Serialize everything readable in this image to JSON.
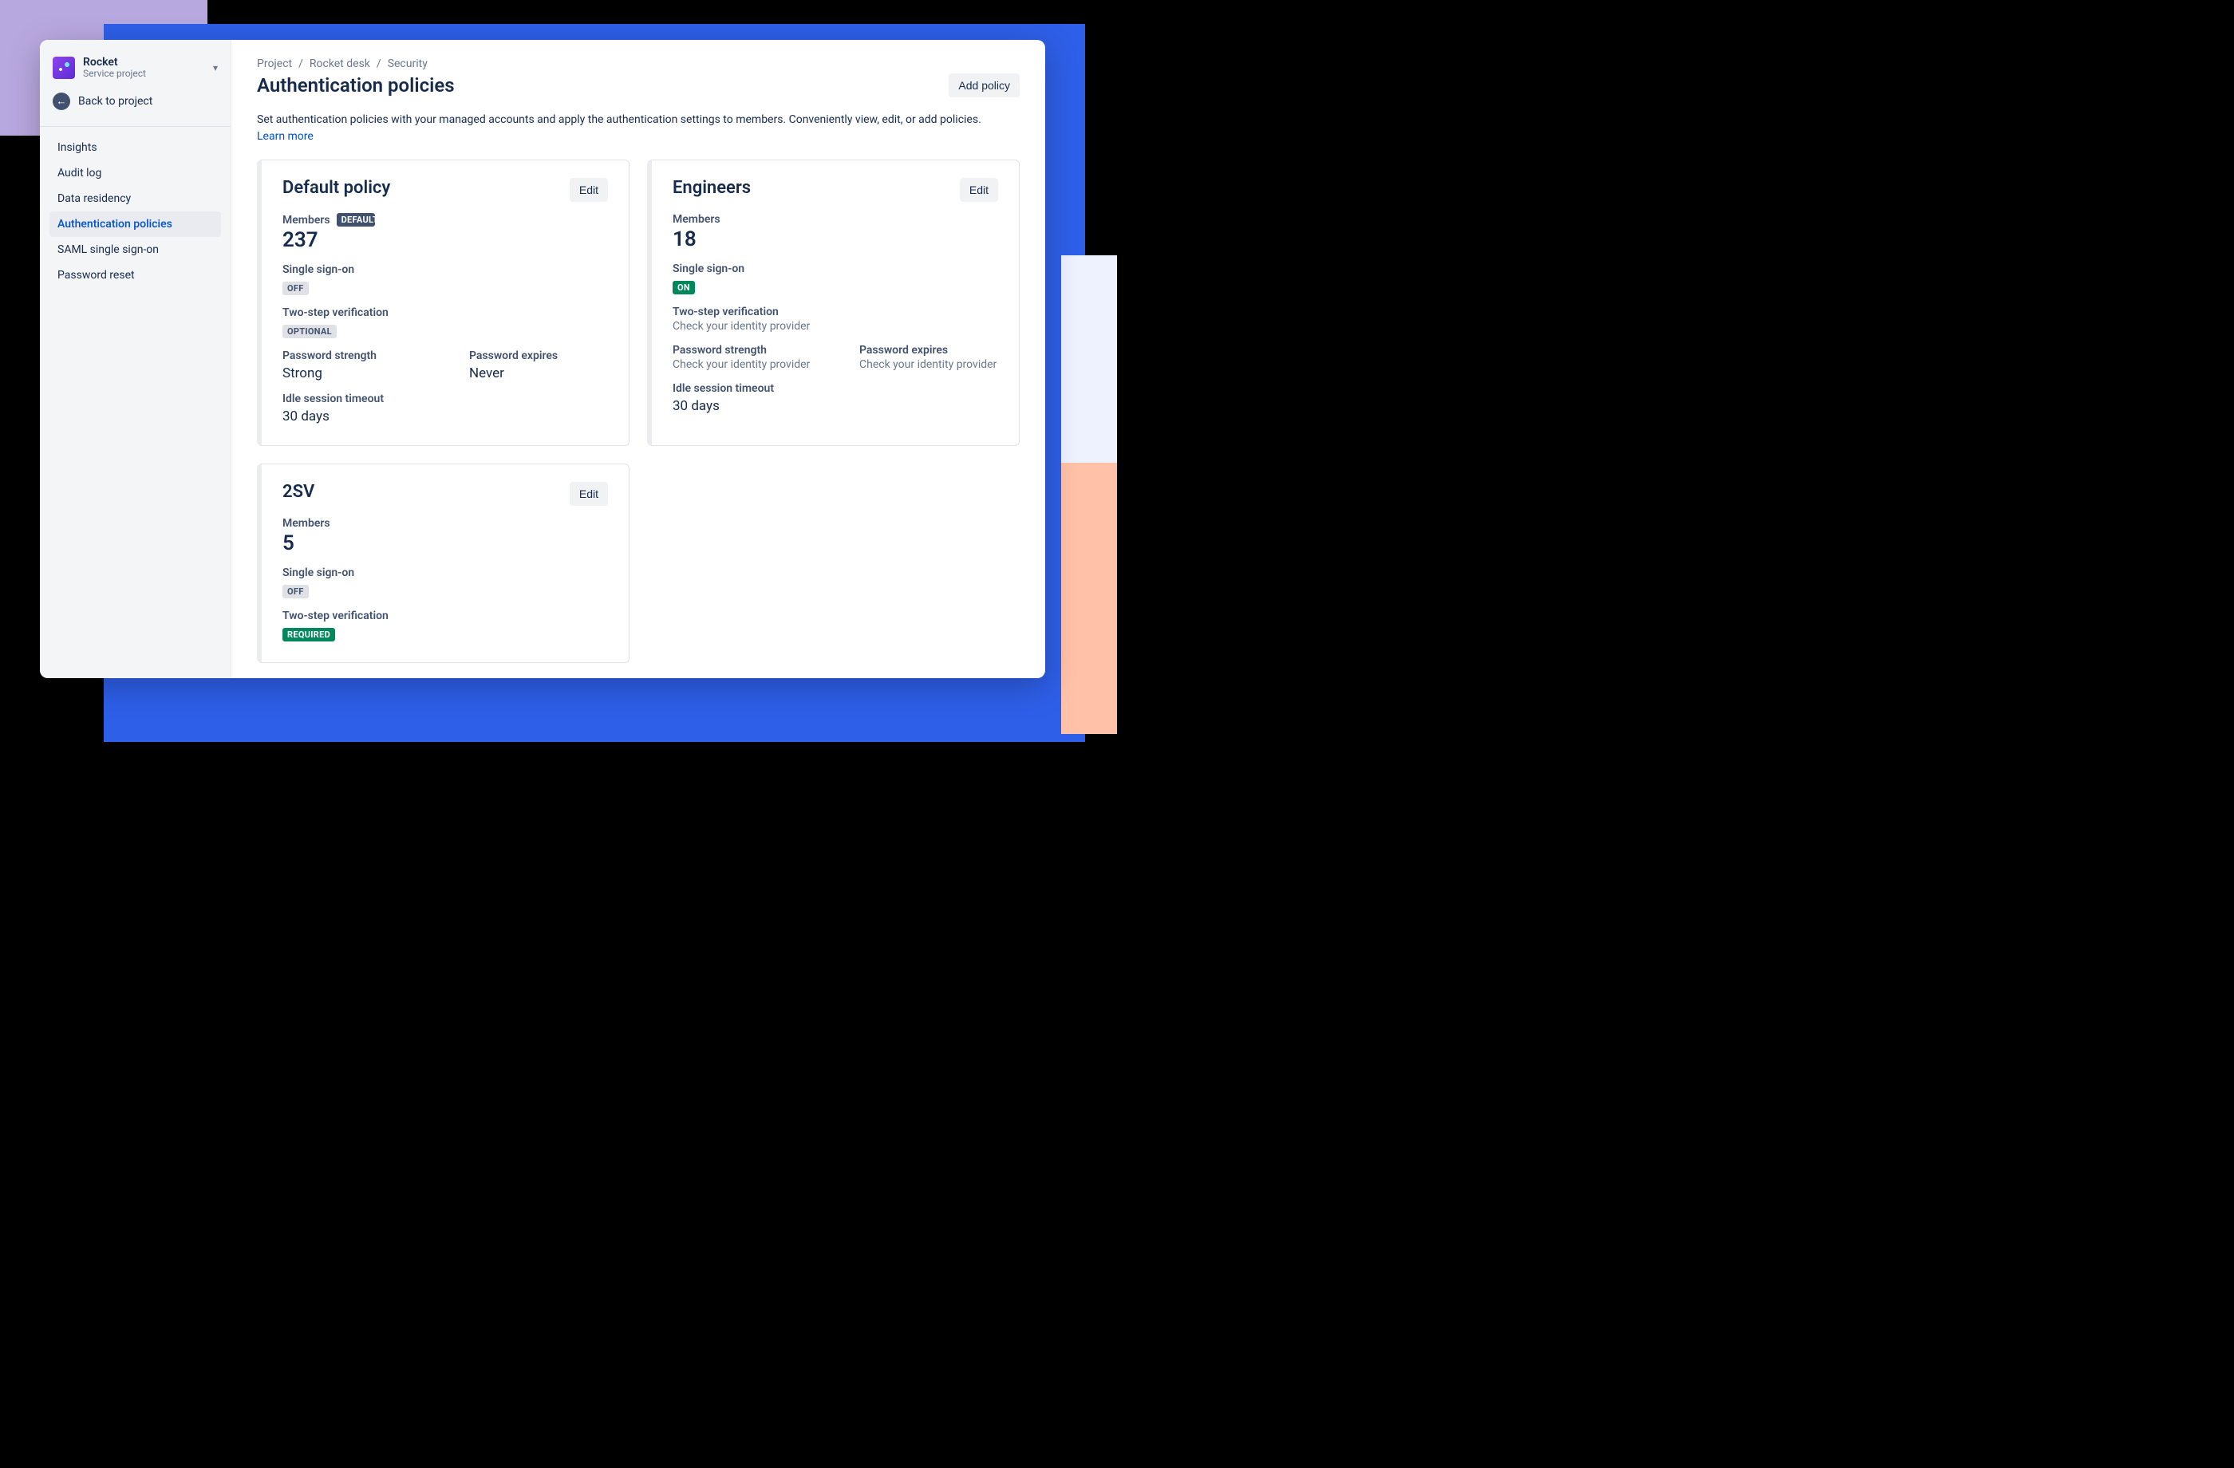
{
  "sidebar": {
    "project_name": "Rocket",
    "project_subtitle": "Service project",
    "back_label": "Back to project",
    "items": [
      {
        "label": "Insights"
      },
      {
        "label": "Audit log"
      },
      {
        "label": "Data residency"
      },
      {
        "label": "Authentication policies"
      },
      {
        "label": "SAML single sign-on"
      },
      {
        "label": "Password reset"
      }
    ],
    "active_index": 3
  },
  "breadcrumb": [
    "Project",
    "Rocket desk",
    "Security"
  ],
  "page_title": "Authentication policies",
  "add_button": "Add policy",
  "subtitle_text": "Set authentication policies with your managed accounts and apply the authentication settings to members. Conveniently view, edit, or add policies. ",
  "learn_more": "Learn more",
  "edit_label": "Edit",
  "labels": {
    "members": "Members",
    "sso": "Single sign-on",
    "twostep": "Two-step verification",
    "pw_strength": "Password strength",
    "pw_expires": "Password expires",
    "idle": "Idle session timeout"
  },
  "policies": [
    {
      "name": "Default policy",
      "members": "237",
      "default_badge": "DEFAULT",
      "sso_badge": "OFF",
      "sso_style": "grey",
      "twostep_mode": "badge",
      "twostep_badge": "OPTIONAL",
      "twostep_style": "grey",
      "pw_strength": "Strong",
      "pw_expires": "Never",
      "idle": "30 days"
    },
    {
      "name": "Engineers",
      "members": "18",
      "sso_badge": "ON",
      "sso_style": "green",
      "twostep_mode": "text",
      "twostep_text": "Check your identity provider",
      "pw_strength_text": "Check your identity provider",
      "pw_expires_text": "Check your identity provider",
      "idle": "30 days"
    },
    {
      "name": "2SV",
      "members": "5",
      "sso_badge": "OFF",
      "sso_style": "grey",
      "twostep_mode": "badge",
      "twostep_badge": "REQUIRED",
      "twostep_style": "green"
    }
  ]
}
